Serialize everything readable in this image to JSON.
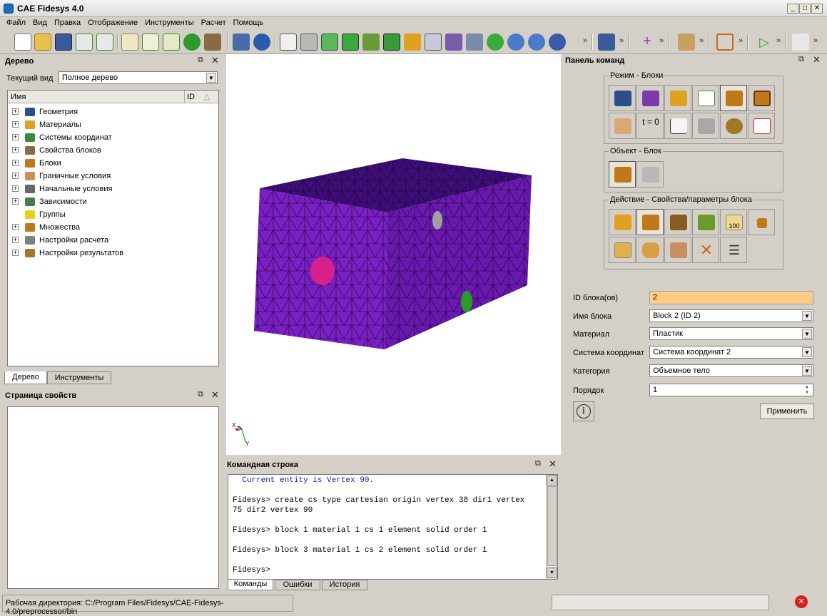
{
  "window": {
    "title": "CAE Fidesys 4.0",
    "minimize": "_",
    "maximize": "□",
    "close": "✕"
  },
  "menu": [
    "Файл",
    "Вид",
    "Правка",
    "Отображение",
    "Инструменты",
    "Расчет",
    "Помощь"
  ],
  "tree_panel": {
    "title": "Дерево",
    "view_label": "Текущий вид",
    "view_value": "Полное дерево",
    "col_name": "Имя",
    "col_id": "ID",
    "items": [
      {
        "label": "Геометрия",
        "icon": "geometry-icon",
        "color": "#2b4f8a"
      },
      {
        "label": "Материалы",
        "icon": "materials-icon",
        "color": "#e0a020"
      },
      {
        "label": "Системы координат",
        "icon": "coord-system-icon",
        "color": "#3a8a3a"
      },
      {
        "label": "Свойства блоков",
        "icon": "block-properties-icon",
        "color": "#8a6a40"
      },
      {
        "label": "Блоки",
        "icon": "blocks-icon",
        "color": "#c07818"
      },
      {
        "label": "Граничные условия",
        "icon": "boundary-conditions-icon",
        "color": "#c89060"
      },
      {
        "label": "Начальные условия",
        "icon": "initial-conditions-icon",
        "color": "#666666"
      },
      {
        "label": "Зависимости",
        "icon": "dependencies-icon",
        "color": "#4a7a4a"
      },
      {
        "label": "Группы",
        "icon": "groups-icon",
        "color": "#e8d020"
      },
      {
        "label": "Множества",
        "icon": "sets-icon",
        "color": "#c07818"
      },
      {
        "label": "Настройки расчета",
        "icon": "calc-settings-icon",
        "color": "#808080"
      },
      {
        "label": "Настройки результатов",
        "icon": "results-settings-icon",
        "color": "#a07828"
      }
    ],
    "tabs": [
      "Дерево",
      "Инструменты"
    ]
  },
  "props_panel": {
    "title": "Страница свойств"
  },
  "viewport": {
    "axis_labels": {
      "x": "X",
      "y": "Y",
      "z": "Z"
    }
  },
  "command_line": {
    "title": "Командная строка",
    "lines": [
      {
        "text": "  Current entity is Vertex 90.",
        "color": "#1a1aa8"
      },
      {
        "text": "",
        "color": "#000"
      },
      {
        "text": "Fidesys> create cs type cartesian origin vertex 38 dir1 vertex",
        "color": "#000"
      },
      {
        "text": "75 dir2 vertex 90",
        "color": "#000"
      },
      {
        "text": "",
        "color": "#000"
      },
      {
        "text": "Fidesys> block 1 material 1 cs 1 element solid order 1",
        "color": "#000"
      },
      {
        "text": "",
        "color": "#000"
      },
      {
        "text": "Fidesys> block 3 material 1 cs 2 element solid order 1",
        "color": "#000"
      },
      {
        "text": "",
        "color": "#000"
      },
      {
        "text": "Fidesys>",
        "color": "#000"
      }
    ],
    "tabs": [
      "Команды",
      "Ошибки",
      "История"
    ]
  },
  "command_panel": {
    "title": "Панель команд",
    "mode_group": "Режим - Блоки",
    "object_group": "Объект - Блок",
    "action_group": "Действие - Свойства/параметры блока",
    "t0_label": "t = 0",
    "count_label": "100",
    "form": {
      "id_label": "ID блока(ов)",
      "id_value": "2",
      "name_label": "Имя блока",
      "name_value": "Block 2 (ID 2)",
      "material_label": "Материал",
      "material_value": "Пластик",
      "cs_label": "Система координат",
      "cs_value": "Система координат 2",
      "category_label": "Категория",
      "category_value": "Объемное тело",
      "order_label": "Порядок",
      "order_value": "1",
      "apply": "Применить",
      "info": "i"
    }
  },
  "status": {
    "text": "Рабочая директория: C:/Program Files/Fidesys/CAE-Fidesys-4.0/preprocessor/bin"
  },
  "colors": {
    "accent": "#ffcc88",
    "mesh": "#7a1fc4",
    "meshtop": "#4a1090"
  }
}
